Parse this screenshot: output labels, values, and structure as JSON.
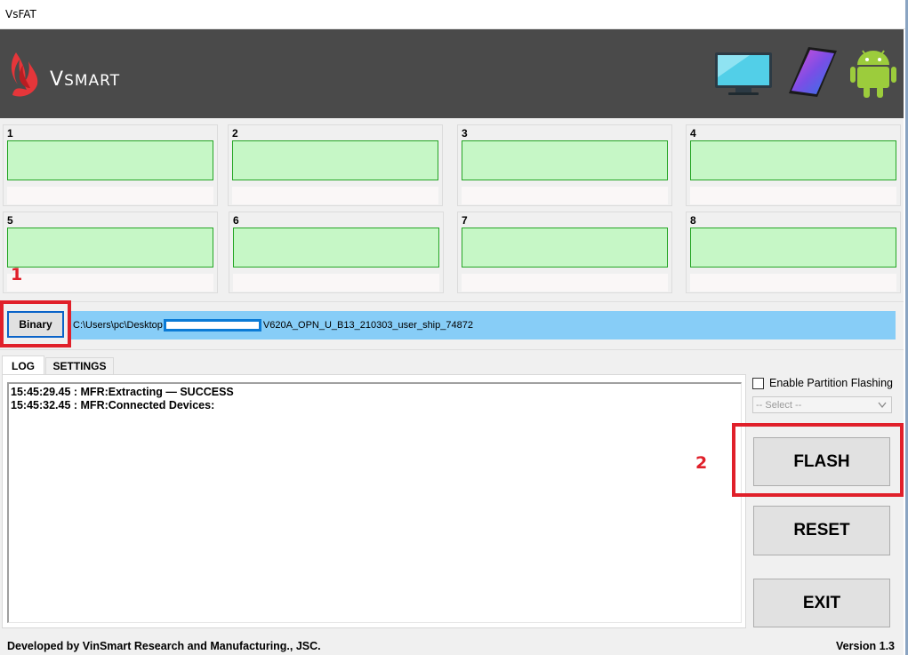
{
  "window": {
    "title": "VsFAT"
  },
  "banner": {
    "brand_big": "V",
    "brand_small": "SMART"
  },
  "slots": [
    {
      "number": "1"
    },
    {
      "number": "2"
    },
    {
      "number": "3"
    },
    {
      "number": "4"
    },
    {
      "number": "5"
    },
    {
      "number": "6"
    },
    {
      "number": "7"
    },
    {
      "number": "8"
    }
  ],
  "annotations": {
    "marker_1": "1",
    "marker_2": "2"
  },
  "binary": {
    "button_label": "Binary",
    "path_prefix": "C:\\Users\\pc\\Desktop",
    "path_suffix": "V620A_OPN_U_B13_210303_user_ship_74872"
  },
  "tabs": [
    {
      "label": "LOG"
    },
    {
      "label": "SETTINGS"
    }
  ],
  "log": {
    "lines": [
      "15:45:29.45 : MFR:Extracting — SUCCESS",
      "15:45:32.45 : MFR:Connected Devices:"
    ]
  },
  "options": {
    "enable_partition_label": "Enable Partition Flashing",
    "select_value": "-- Select --"
  },
  "actions": {
    "flash": "FLASH",
    "reset": "RESET",
    "exit": "EXIT"
  },
  "footer": {
    "developer": "Developed by VinSmart Research and Manufacturing., JSC.",
    "version": "Version 1.3"
  },
  "colors": {
    "banner_bg": "#4a4a4a",
    "slot_status_fill": "#c6f7c6",
    "slot_status_border": "#25a525",
    "path_bg": "#87cdf7",
    "annotation_red": "#e0202a"
  }
}
